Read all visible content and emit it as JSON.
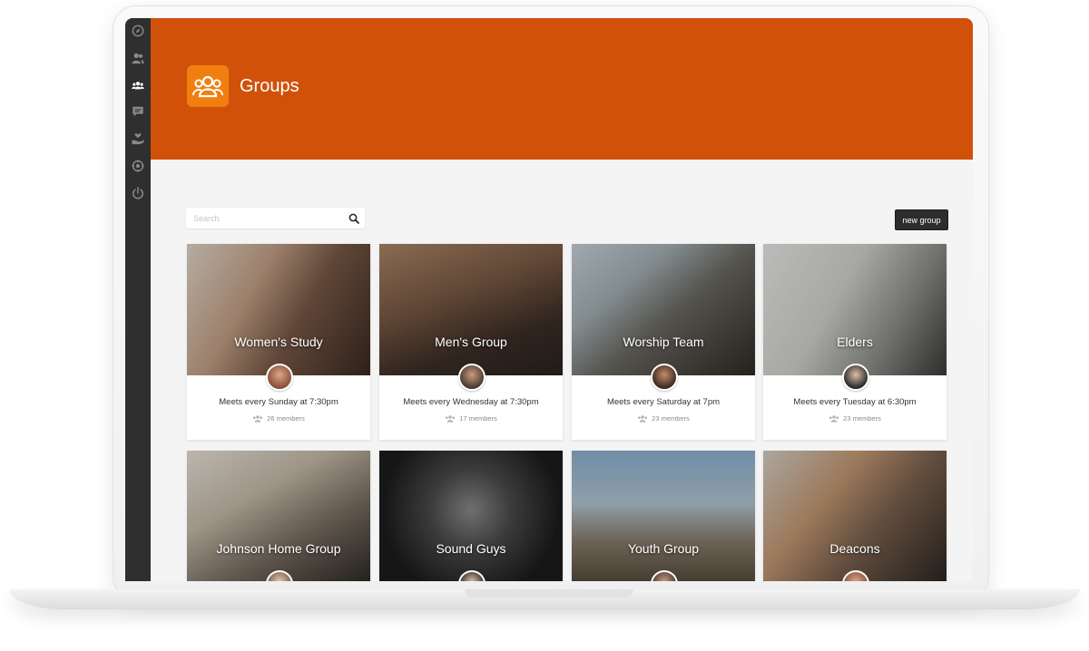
{
  "app": {
    "title": "Groups"
  },
  "colors": {
    "header": "#d1510a",
    "accent": "#f07f10",
    "sidebar": "#2f2f2f"
  },
  "sidebar": {
    "items": [
      {
        "icon": "compass-icon",
        "active": false
      },
      {
        "icon": "users-icon",
        "active": false
      },
      {
        "icon": "group-icon",
        "active": true
      },
      {
        "icon": "chat-icon",
        "active": false
      },
      {
        "icon": "donate-icon",
        "active": false
      },
      {
        "icon": "settings-icon",
        "active": false
      },
      {
        "icon": "power-icon",
        "active": false
      }
    ]
  },
  "toolbar": {
    "search_placeholder": "Search",
    "search_icon": "search-icon",
    "new_group_label": "new group"
  },
  "groups": [
    {
      "name": "Women's Study",
      "meets": "Meets every Sunday at 7:30pm",
      "members": "26 members"
    },
    {
      "name": "Men's Group",
      "meets": "Meets every Wednesday at 7:30pm",
      "members": "17 members"
    },
    {
      "name": "Worship Team",
      "meets": "Meets every Saturday at 7pm",
      "members": "23 members"
    },
    {
      "name": "Elders",
      "meets": "Meets every Tuesday at 6:30pm",
      "members": "23 members"
    },
    {
      "name": "Johnson Home Group"
    },
    {
      "name": "Sound Guys"
    },
    {
      "name": "Youth Group"
    },
    {
      "name": "Deacons"
    }
  ]
}
